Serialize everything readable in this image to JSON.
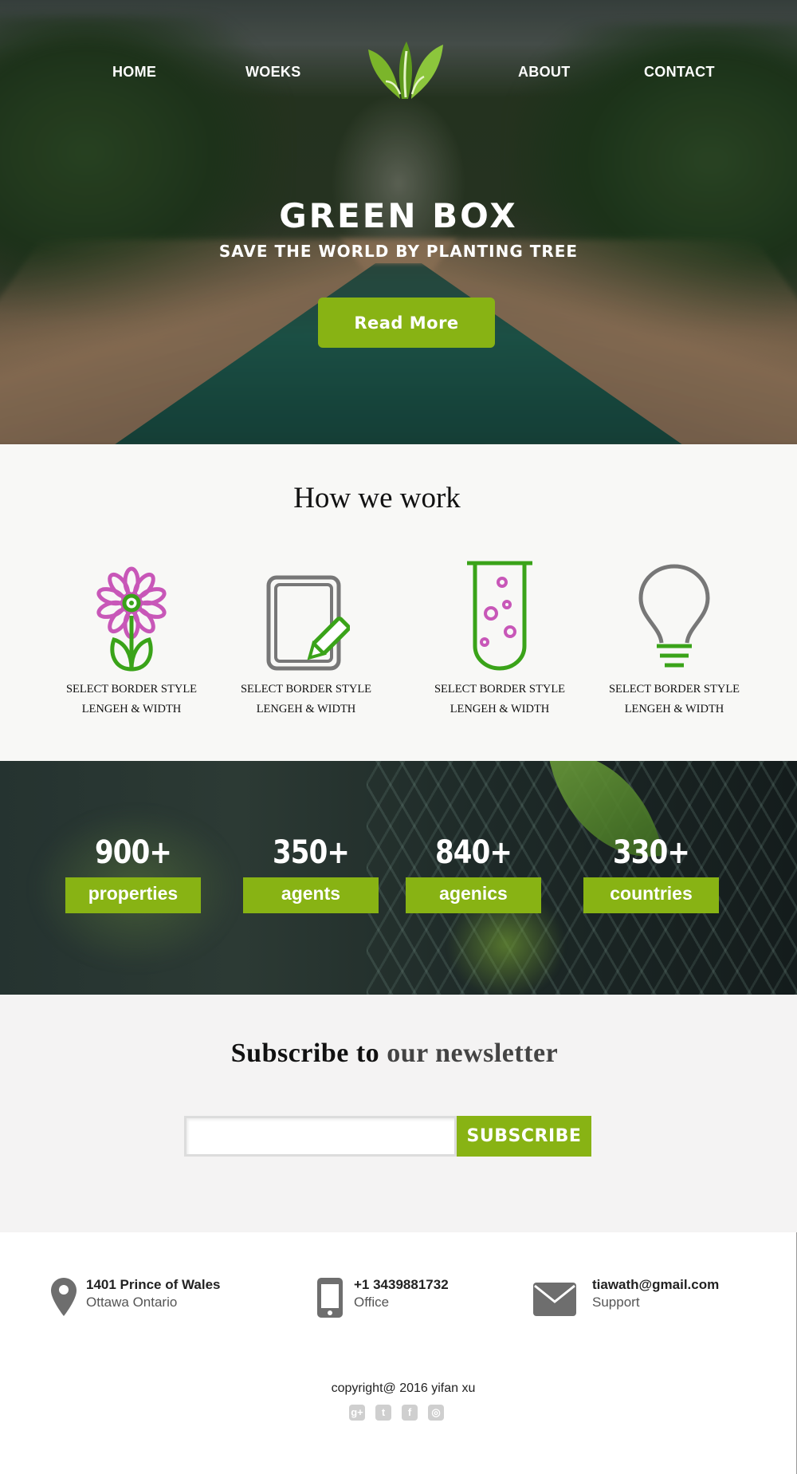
{
  "nav": {
    "home": "HOME",
    "works": "WOEKS",
    "about": "ABOUT",
    "contact": "CONTACT"
  },
  "hero": {
    "title": "GREEN BOX",
    "subtitle": "SAVE THE WORLD BY PLANTING TREE",
    "button": "Read More"
  },
  "how": {
    "title": "How we work",
    "features": [
      {
        "icon": "flower-icon",
        "text": "SELECT BORDER STYLE\nLENGEH & WIDTH"
      },
      {
        "icon": "notepad-pencil-icon",
        "text": "SELECT BORDER STYLE\nLENGEH & WIDTH"
      },
      {
        "icon": "test-tube-icon",
        "text": "SELECT BORDER STYLE\nLENGEH & WIDTH"
      },
      {
        "icon": "light-bulb-icon",
        "text": "SELECT BORDER STYLE\nLENGEH & WIDTH"
      }
    ]
  },
  "stats": [
    {
      "number": "900+",
      "label": "properties"
    },
    {
      "number": "350+",
      "label": "agents"
    },
    {
      "number": "840+",
      "label": "agenics"
    },
    {
      "number": "330+",
      "label": "countries"
    }
  ],
  "subscribe": {
    "title_part1": "Subscribe  to",
    "title_part2": "our newsletter",
    "input_value": "",
    "button": "SUBSCRIBE"
  },
  "contact": {
    "address": {
      "line1": "1401 Prince of Wales",
      "line2": "Ottawa Ontario",
      "icon": "map-pin-icon"
    },
    "phone": {
      "line1": "+1 3439881732",
      "line2": "Office",
      "icon": "phone-icon"
    },
    "email": {
      "line1": "tiawath@gmail.com",
      "line2": "Support",
      "icon": "envelope-icon"
    }
  },
  "footer": {
    "copyright": "copyright@ 2016 yifan xu",
    "social": [
      "google-plus-icon",
      "twitter-icon",
      "facebook-icon",
      "instagram-icon"
    ]
  },
  "colors": {
    "accent": "#88b314",
    "feature_green": "#3aa319",
    "feature_pink": "#c857b8",
    "icon_gray": "#777777"
  }
}
